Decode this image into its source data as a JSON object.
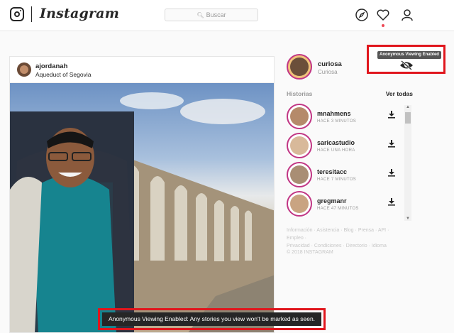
{
  "header": {
    "wordmark": "Instagram",
    "search_placeholder": "Buscar",
    "icons": [
      "instagram-camera-icon",
      "compass-icon",
      "heart-icon",
      "user-icon"
    ],
    "notification_color": "#ed4956"
  },
  "post": {
    "username": "ajordanah",
    "location": "Aqueduct of Segovia"
  },
  "profile": {
    "username": "curiosa",
    "fullname": "Curiosa"
  },
  "anonymous": {
    "tooltip": "Anonymous Viewing Enabled",
    "banner": "Anonymous Viewing Enabled: Any stories you view won't be marked as seen.",
    "highlight_color": "#e0161d"
  },
  "stories": {
    "title": "Historias",
    "see_all": "Ver todas",
    "items": [
      {
        "name": "mnahmens",
        "time": "HACE 3 MINUTOS"
      },
      {
        "name": "saricastudio",
        "time": "HACE UNA HORA"
      },
      {
        "name": "teresitacc",
        "time": "HACE 7 MINUTOS"
      },
      {
        "name": "gregmanr",
        "time": "HACE 47 MINUTOS"
      }
    ]
  },
  "footer": {
    "links": [
      "Información",
      "Asistencia",
      "Blog",
      "Prensa",
      "API",
      "Empleo",
      "Privacidad",
      "Condiciones",
      "Directorio",
      "Idioma"
    ],
    "copyright": "© 2018 INSTAGRAM"
  }
}
